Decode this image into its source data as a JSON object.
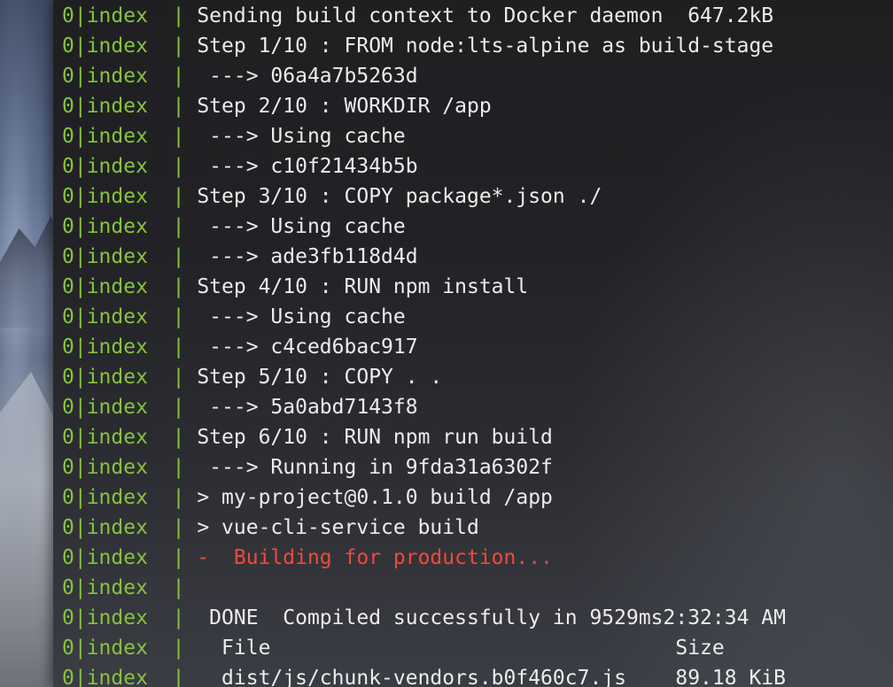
{
  "terminal": {
    "prefix": "0|index  | ",
    "lines": [
      {
        "text": "Sending build context to Docker daemon  647.2kB",
        "color": "default"
      },
      {
        "text": "Step 1/10 : FROM node:lts-alpine as build-stage",
        "color": "default"
      },
      {
        "text": " ---> 06a4a7b5263d",
        "color": "default"
      },
      {
        "text": "Step 2/10 : WORKDIR /app",
        "color": "default"
      },
      {
        "text": " ---> Using cache",
        "color": "default"
      },
      {
        "text": " ---> c10f21434b5b",
        "color": "default"
      },
      {
        "text": "Step 3/10 : COPY package*.json ./",
        "color": "default"
      },
      {
        "text": " ---> Using cache",
        "color": "default"
      },
      {
        "text": " ---> ade3fb118d4d",
        "color": "default"
      },
      {
        "text": "Step 4/10 : RUN npm install",
        "color": "default"
      },
      {
        "text": " ---> Using cache",
        "color": "default"
      },
      {
        "text": " ---> c4ced6bac917",
        "color": "default"
      },
      {
        "text": "Step 5/10 : COPY . .",
        "color": "default"
      },
      {
        "text": " ---> 5a0abd7143f8",
        "color": "default"
      },
      {
        "text": "Step 6/10 : RUN npm run build",
        "color": "default"
      },
      {
        "text": " ---> Running in 9fda31a6302f",
        "color": "default"
      },
      {
        "text": "> my-project@0.1.0 build /app",
        "color": "default"
      },
      {
        "text": "> vue-cli-service build",
        "color": "default"
      },
      {
        "text": "-  Building for production...",
        "color": "error"
      },
      {
        "text": "",
        "color": "default"
      },
      {
        "text": " DONE  Compiled successfully in 9529ms2:32:34 AM",
        "color": "default"
      },
      {
        "text": "  File                                 Size",
        "color": "default"
      },
      {
        "text": "  dist/js/chunk-vendors.b0f460c7.js    89.18 KiB",
        "color": "default"
      }
    ]
  },
  "colors": {
    "prefix": "#86c43d",
    "text": "#ececec",
    "error": "#f04a3a"
  }
}
